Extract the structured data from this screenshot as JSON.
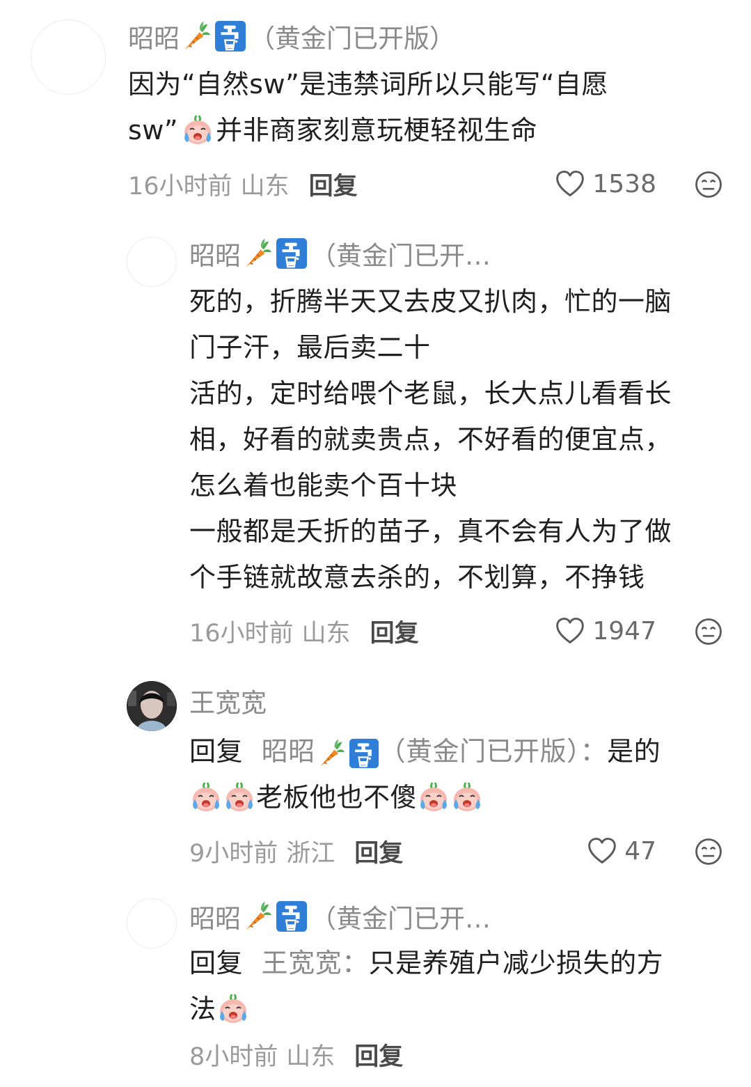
{
  "comments": [
    {
      "nickname": "昭昭",
      "tag": "（黄金门已开版）",
      "text": [
        "因为“自然sw”是违禁词所以只能写“自愿",
        "sw”",
        "并非商家刻意玩梗轻视生命"
      ],
      "time": "16小时前",
      "location": "山东",
      "reply_label": "回复",
      "likes": "1538"
    },
    {
      "nickname": "昭昭",
      "tag": "（黄金门已开…",
      "text": [
        "死的，折腾半天又去皮又扒肉，忙的一脑",
        "门子汗，最后卖二十",
        "活的，定时给喂个老鼠，长大点儿看看长",
        "相，好看的就卖贵点，不好看的便宜点，",
        "怎么着也能卖个百十块",
        "一般都是夭折的苗子，真不会有人为了做",
        "个手链就故意去杀的，不划算，不挣钱"
      ],
      "time": "16小时前",
      "location": "山东",
      "reply_label": "回复",
      "likes": "1947"
    },
    {
      "nickname": "王宽宽",
      "reply_prefix": "回复",
      "reply_to_nick": "昭昭",
      "reply_to_tag": "（黄金门已开版）",
      "reply_colon": "：",
      "text": [
        "是的",
        "老板他也不傻"
      ],
      "time": "9小时前",
      "location": "浙江",
      "reply_label": "回复",
      "likes": "47"
    },
    {
      "nickname": "昭昭",
      "tag": "（黄金门已开…",
      "reply_prefix": "回复",
      "reply_to_nick": "王宽宽",
      "reply_colon": "：",
      "text": [
        "只是养殖户减少损失的方",
        "法"
      ],
      "time": "8小时前",
      "location": "山东",
      "reply_label": "回复"
    }
  ],
  "colors": {
    "carrot": "#f08a24",
    "carrot_leaf": "#4caf50",
    "faucet_bg": "#2f7fd8",
    "cry_face": "#f7b8b0",
    "tear": "#5aa8e8"
  },
  "icons": {
    "carrot": "carrot-icon",
    "faucet": "potable-water-icon",
    "cry": "crying-face-icon",
    "heart": "heart-outline-icon",
    "dislike": "neutral-face-icon"
  }
}
